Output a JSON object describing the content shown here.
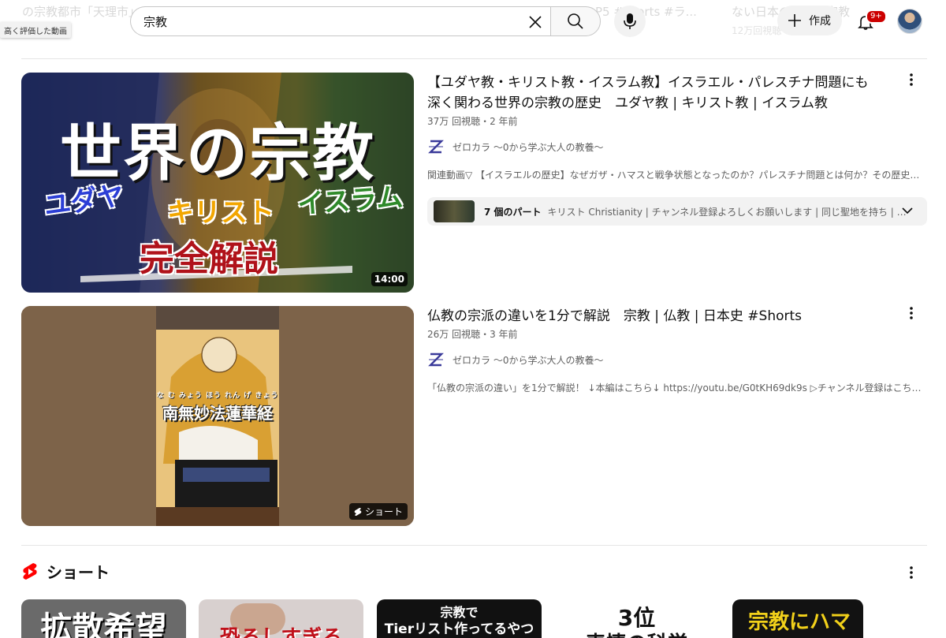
{
  "background_results": [
    {
      "text": "の宗教都市「天理市」"
    },
    {
      "text": "P5 #shorts #ラ..."
    },
    {
      "text": "ない日本のカルト宗教"
    }
  ],
  "background_sub": [
    {
      "text": "高く評価した動画"
    },
    {
      "text": "12万回視聴"
    }
  ],
  "tooltip": "高く評価した動画",
  "search": {
    "value": "宗教",
    "placeholder": "検索"
  },
  "header": {
    "create_label": "作成",
    "notifications_badge": "9+"
  },
  "results": [
    {
      "title": "【ユダヤ教・キリスト教・イスラム教】イスラエル・パレスチナ問題にも深く関わる世界の宗教の歴史　ユダヤ教 | キリスト教 | イスラム教",
      "meta": "37万 回視聴・2 年前",
      "channel": "ゼロカラ 〜0から学ぶ大人の教養〜",
      "description": "関連動画▽ 【イスラエルの歴史】なぜガザ・ハマスと戦争状態となったのか？パレスチナ問題とは何か？その歴史的...",
      "duration": "14:00",
      "thumb_text": {
        "main": "世界の宗教",
        "left": "ユダヤ",
        "center": "キリスト",
        "right": "イスラム",
        "bottom": "完全解説"
      },
      "chapters": {
        "count": "7 個のパート",
        "text": "キリスト Christianity | チャンネル登録よろしくお願いします | 同じ聖地を持ち | 5..."
      }
    },
    {
      "title": "仏教の宗派の違いを1分で解説　宗教 | 仏教 | 日本史 #Shorts",
      "meta": "26万 回視聴・3 年前",
      "channel": "ゼロカラ 〜0から学ぶ大人の教養〜",
      "description": "「仏教の宗派の違い」を1分で解説！ ↓本編はこちら↓ https://youtu.be/G0tKH69dk9s ▷チャンネル登録はこちら：...",
      "thumb_text": {
        "ruby": "な む みょう ほう れん げ きょう",
        "main": "南無妙法蓮華経"
      },
      "shorts_label": "ショート"
    }
  ],
  "shelf": {
    "title": "ショート",
    "cards": [
      {
        "text": "拡散希望",
        "sub": ""
      },
      {
        "text": "恐ろしすぎる",
        "sub": ""
      },
      {
        "text": "宗教で",
        "sub": "Tierリスト作ってるやつ"
      },
      {
        "text": "3位",
        "sub": "表情の科学"
      },
      {
        "text": "宗教にハマ",
        "sub": ""
      }
    ]
  },
  "colors": {
    "accent_red": "#ff0000",
    "badge_red": "#cc0000",
    "meta_gray": "#606060"
  }
}
